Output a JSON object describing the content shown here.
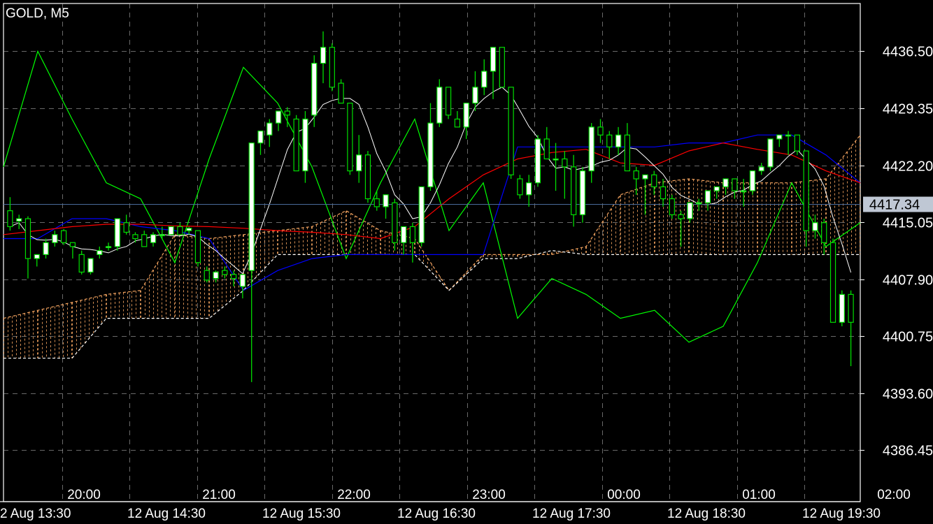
{
  "header": {
    "symbol_timeframe": "GOLD, M5"
  },
  "price_axis": {
    "ticks": [
      "4436.50",
      "4429.35",
      "4422.20",
      "4415.05",
      "4407.90",
      "4400.75",
      "4393.60",
      "4386.45"
    ],
    "current_price_label": "4417.34",
    "current_price": 4417.34
  },
  "time_axis": {
    "upper_labels": [
      "20:00",
      "21:00",
      "22:00",
      "23:00",
      "00:00",
      "01:00",
      "02:00"
    ],
    "lower_labels": [
      "2 Aug 13:30",
      "12 Aug 14:30",
      "12 Aug 15:30",
      "12 Aug 16:30",
      "12 Aug 17:30",
      "12 Aug 18:30",
      "12 Aug 19:30"
    ]
  },
  "colors": {
    "background": "#000000",
    "grid": "#c0c0c0",
    "bull_candle": "#ffffff",
    "bear_candle": "#000000",
    "wick": "#00dd00",
    "tenkan": "#ff0000",
    "kijun": "#0000ff",
    "chikou": "#00ff00",
    "span_a": "#f4a460",
    "span_b": "#ffffff",
    "price_line": "#4a6a9a",
    "price_label_bg": "#bfc7d4"
  },
  "chart_data": {
    "type": "candlestick",
    "title": "GOLD, M5",
    "ylim": [
      4380.0,
      4442.5
    ],
    "grid": true,
    "candles": [
      [
        4416.5,
        4418.2,
        4414.0,
        4414.5
      ],
      [
        4415.2,
        4416.0,
        4414.2,
        4415.5
      ],
      [
        4415.5,
        4415.8,
        4408.0,
        4410.5
      ],
      [
        4410.5,
        4411.0,
        4409.5,
        4411.0
      ],
      [
        4411.0,
        4413.0,
        4410.5,
        4412.5
      ],
      [
        4412.5,
        4414.0,
        4412.0,
        4413.5
      ],
      [
        4414.0,
        4414.2,
        4412.2,
        4412.5
      ],
      [
        4412.5,
        4412.5,
        4410.5,
        4412.0
      ],
      [
        4411.0,
        4411.5,
        4408.5,
        4408.8
      ],
      [
        4408.8,
        4410.5,
        4408.5,
        4410.5
      ],
      [
        4411.0,
        4412.0,
        4410.5,
        4411.5
      ],
      [
        4412.0,
        4412.5,
        4411.5,
        4412.0
      ],
      [
        4412.0,
        4415.5,
        4411.5,
        4415.5
      ],
      [
        4415.0,
        4416.0,
        4413.5,
        4413.8
      ],
      [
        4413.5,
        4413.8,
        4412.5,
        4413.0
      ],
      [
        4413.5,
        4414.0,
        4412.0,
        4412.0
      ],
      [
        4412.5,
        4413.8,
        4412.0,
        4413.5
      ],
      [
        4413.5,
        4414.5,
        4413.0,
        4413.5
      ],
      [
        4413.5,
        4414.5,
        4413.5,
        4414.5
      ],
      [
        4414.5,
        4415.0,
        4413.5,
        4413.5
      ],
      [
        4414.0,
        4414.5,
        4413.5,
        4414.3
      ],
      [
        4414.0,
        4414.0,
        4409.5,
        4410.0
      ],
      [
        4409.0,
        4409.5,
        4407.5,
        4407.8
      ],
      [
        4408.0,
        4409.0,
        4407.5,
        4408.8
      ],
      [
        4409.0,
        4409.5,
        4408.0,
        4408.5
      ],
      [
        4408.5,
        4409.0,
        4407.0,
        4408.0
      ],
      [
        4407.0,
        4408.0,
        4405.5,
        4408.5
      ],
      [
        4409.0,
        4410.0,
        4395.0,
        4425.0
      ],
      [
        4425.0,
        4426.0,
        4423.5,
        4426.5
      ],
      [
        4426.0,
        4428.0,
        4424.5,
        4427.5
      ],
      [
        4427.5,
        4429.0,
        4426.5,
        4429.0
      ],
      [
        4429.0,
        4429.5,
        4427.0,
        4428.5
      ],
      [
        4428.0,
        4428.5,
        4421.5,
        4421.5
      ],
      [
        4421.5,
        4429.0,
        4420.0,
        4428.0
      ],
      [
        4428.5,
        4436.0,
        4427.0,
        4435.0
      ],
      [
        4435.0,
        4439.0,
        4432.5,
        4437.0
      ],
      [
        4437.0,
        4437.5,
        4431.5,
        4432.0
      ],
      [
        4432.5,
        4433.0,
        4430.5,
        4430.0
      ],
      [
        4430.0,
        4430.0,
        4421.0,
        4421.5
      ],
      [
        4421.5,
        4426.0,
        4420.0,
        4423.5
      ],
      [
        4423.5,
        4424.0,
        4417.5,
        4418.0
      ],
      [
        4418.0,
        4419.0,
        4416.5,
        4417.0
      ],
      [
        4417.0,
        4418.5,
        4415.5,
        4418.5
      ],
      [
        4417.5,
        4418.0,
        4411.5,
        4412.5
      ],
      [
        4412.5,
        4414.0,
        4411.0,
        4414.5
      ],
      [
        4414.5,
        4415.0,
        4410.0,
        4412.5
      ],
      [
        4412.5,
        4419.5,
        4412.0,
        4419.5
      ],
      [
        4419.5,
        4430.0,
        4419.0,
        4427.5
      ],
      [
        4427.5,
        4433.0,
        4427.0,
        4432.0
      ],
      [
        4432.0,
        4432.0,
        4428.0,
        4428.5
      ],
      [
        4428.0,
        4429.0,
        4427.0,
        4427.0
      ],
      [
        4427.0,
        4428.0,
        4425.5,
        4430.0
      ],
      [
        4430.0,
        4434.0,
        4429.0,
        4432.0
      ],
      [
        4432.0,
        4435.5,
        4431.0,
        4434.0
      ],
      [
        4434.0,
        4436.0,
        4430.5,
        4437.0
      ],
      [
        4437.0,
        4437.0,
        4432.5,
        4432.0
      ],
      [
        4432.0,
        4432.0,
        4420.5,
        4421.0
      ],
      [
        4420.5,
        4421.0,
        4418.0,
        4418.5
      ],
      [
        4418.5,
        4421.0,
        4417.0,
        4420.0
      ],
      [
        4420.0,
        4426.0,
        4419.5,
        4425.5
      ],
      [
        4425.5,
        4427.0,
        4423.0,
        4423.0
      ],
      [
        4423.0,
        4425.0,
        4419.0,
        4423.0
      ],
      [
        4423.0,
        4424.0,
        4418.0,
        4422.0
      ],
      [
        4422.0,
        4423.5,
        4414.5,
        4416.0
      ],
      [
        4416.0,
        4422.0,
        4415.0,
        4421.5
      ],
      [
        4421.5,
        4427.5,
        4420.0,
        4427.0
      ],
      [
        4427.0,
        4428.0,
        4425.0,
        4426.0
      ],
      [
        4426.0,
        4426.5,
        4423.0,
        4424.5
      ],
      [
        4424.5,
        4427.0,
        4423.5,
        4426.0
      ],
      [
        4426.0,
        4427.5,
        4421.5,
        4421.5
      ],
      [
        4421.5,
        4422.0,
        4418.5,
        4420.5
      ],
      [
        4420.5,
        4421.0,
        4416.0,
        4421.0
      ],
      [
        4421.0,
        4421.5,
        4418.5,
        4419.5
      ],
      [
        4419.5,
        4420.5,
        4417.0,
        4418.0
      ],
      [
        4418.0,
        4418.5,
        4415.5,
        4416.0
      ],
      [
        4416.0,
        4416.5,
        4412.0,
        4415.5
      ],
      [
        4415.5,
        4417.0,
        4415.0,
        4417.5
      ],
      [
        4417.5,
        4418.0,
        4416.5,
        4417.5
      ],
      [
        4417.5,
        4419.0,
        4416.5,
        4419.0
      ],
      [
        4419.0,
        4419.5,
        4418.0,
        4419.5
      ],
      [
        4419.5,
        4420.0,
        4418.5,
        4420.5
      ],
      [
        4420.5,
        4420.5,
        4418.0,
        4419.0
      ],
      [
        4419.0,
        4420.5,
        4417.0,
        4419.0
      ],
      [
        4419.0,
        4421.5,
        4418.5,
        4421.5
      ],
      [
        4421.5,
        4422.5,
        4421.0,
        4422.0
      ],
      [
        4422.0,
        4425.0,
        4421.5,
        4425.5
      ],
      [
        4425.5,
        4426.0,
        4424.5,
        4426.0
      ],
      [
        4426.0,
        4426.5,
        4423.5,
        4426.0
      ],
      [
        4426.0,
        4426.0,
        4423.5,
        4424.0
      ],
      [
        4424.0,
        4424.0,
        4412.0,
        4414.0
      ],
      [
        4414.0,
        4416.0,
        4413.0,
        4415.0
      ],
      [
        4415.0,
        4415.5,
        4411.0,
        4412.5
      ],
      [
        4412.5,
        4413.0,
        4403.0,
        4402.5
      ],
      [
        4402.5,
        4406.5,
        4402.0,
        4406.0
      ],
      [
        4406.0,
        4406.5,
        4397.0,
        4402.5
      ]
    ],
    "tenkan": [
      4413.5,
      4414.0,
      4414.5,
      4414.8,
      4414.8,
      4414.6,
      4414.5,
      4414.3,
      4414.0,
      4413.8,
      4413.5,
      4413.0,
      4414.5,
      4418.0,
      4421.0,
      4423.0,
      4423.8,
      4424.2,
      4422.5,
      4422.2,
      4424.0,
      4425.0,
      4424.2,
      4423.5,
      4421.5,
      4420.0
    ],
    "kijun": [
      4413.0,
      4413.0,
      4415.5,
      4415.5,
      4414.5,
      4414.0,
      4413.0,
      4406.5,
      4409.0,
      4410.5,
      4411.0,
      4411.0,
      4411.0,
      4411.0,
      4411.0,
      4424.5,
      4424.5,
      4424.5,
      4424.5,
      4424.5,
      4425.0,
      4425.0,
      4426.0,
      4426.0,
      4423.5,
      4420.0
    ],
    "chikou": [
      4422.0,
      4436.5,
      4428.0,
      4420.0,
      4418.0,
      4410.0,
      4423.0,
      4434.5,
      4430.0,
      4422.0,
      4410.5,
      4420.0,
      4428.0,
      4414.0,
      4420.0,
      4403.0,
      4408.0,
      4406.0,
      4403.0,
      4404.0,
      4400.0,
      4402.0,
      4410.0,
      4420.0,
      4412.0,
      4415.0
    ],
    "span_a": [
      4403.0,
      4404.0,
      4405.0,
      4406.0,
      4406.5,
      4413.5,
      4413.0,
      4413.5,
      4414.0,
      4414.5,
      4416.5,
      4414.0,
      4413.0,
      4406.5,
      4411.0,
      4411.0,
      4411.0,
      4412.0,
      4418.5,
      4420.0,
      4420.5,
      4420.0,
      4420.0,
      4420.0,
      4420.5,
      4426.0
    ],
    "span_b": [
      4398.0,
      4398.0,
      4398.0,
      4403.0,
      4403.0,
      4403.0,
      4403.0,
      4406.5,
      4411.0,
      4411.0,
      4411.0,
      4411.0,
      4411.0,
      4406.5,
      4410.5,
      4410.5,
      4411.5,
      4411.0,
      4411.0,
      4411.0,
      4411.0,
      4411.0,
      4411.0,
      4411.0,
      4411.0,
      4411.0
    ]
  }
}
